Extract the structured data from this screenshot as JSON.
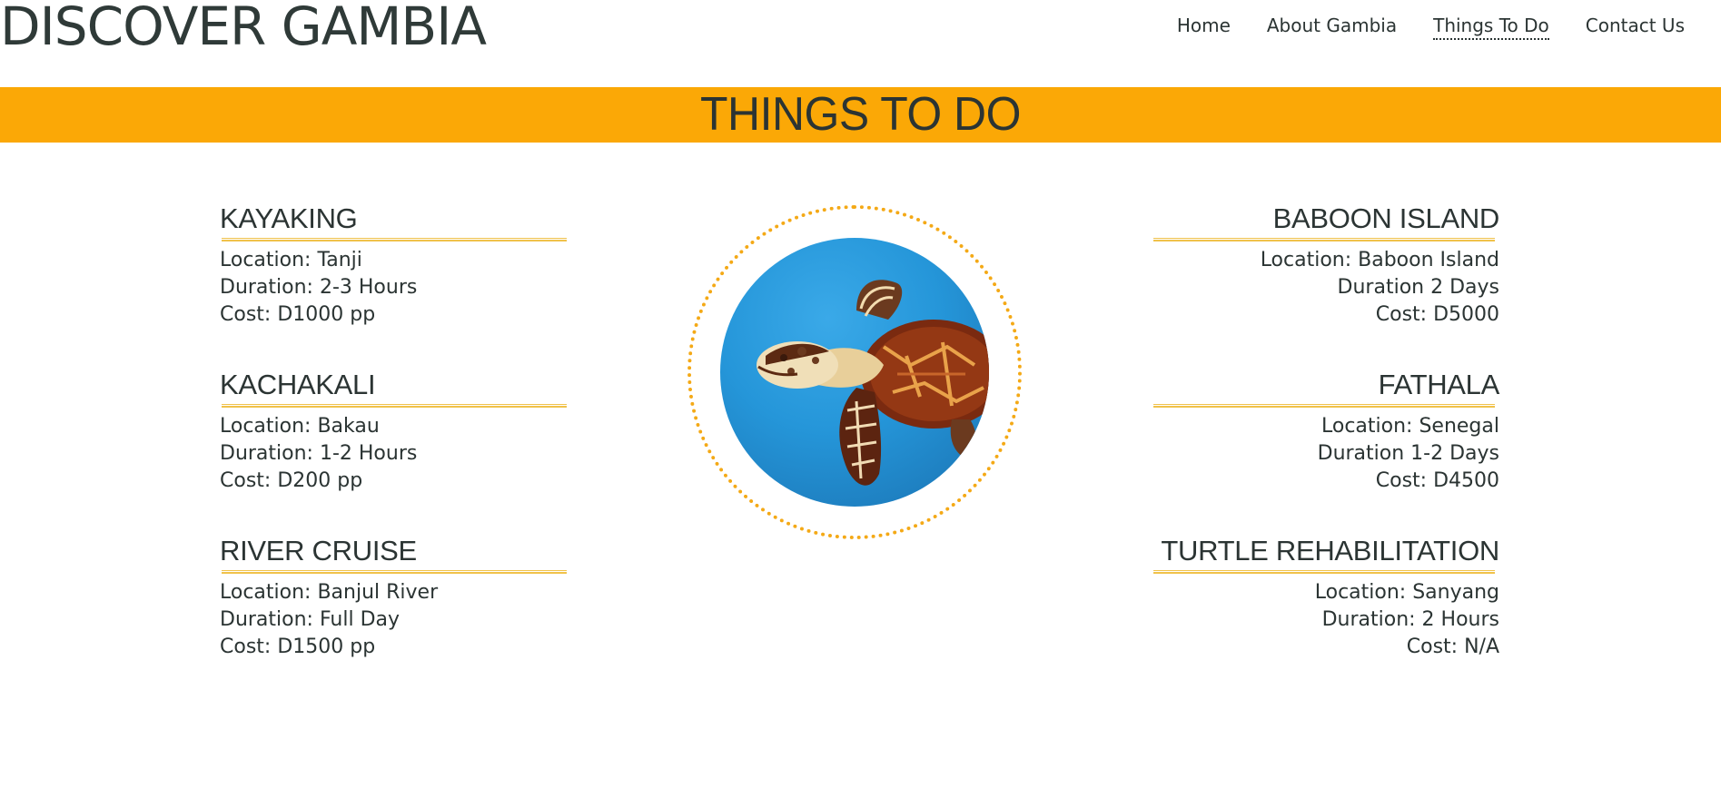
{
  "site": {
    "title": "DISCOVER GAMBIA"
  },
  "nav": {
    "items": [
      {
        "label": "Home"
      },
      {
        "label": "About Gambia"
      },
      {
        "label": "Things To Do"
      },
      {
        "label": "Contact Us"
      }
    ]
  },
  "banner": {
    "title": "THINGS TO DO"
  },
  "activities": {
    "left": [
      {
        "title": "KAYAKING",
        "location": "Location: Tanji",
        "duration": "Duration: 2-3 Hours",
        "cost": "Cost: D1000 pp"
      },
      {
        "title": "KACHAKALI",
        "location": "Location: Bakau",
        "duration": "Duration: 1-2 Hours",
        "cost": "Cost: D200 pp"
      },
      {
        "title": "RIVER CRUISE",
        "location": "Location: Banjul River",
        "duration": "Duration: Full Day",
        "cost": "Cost: D1500 pp"
      }
    ],
    "right": [
      {
        "title": "BABOON ISLAND",
        "location": "Location: Baboon Island",
        "duration": "Duration 2 Days",
        "cost": "Cost: D5000"
      },
      {
        "title": "FATHALA",
        "location": "Location: Senegal",
        "duration": "Duration 1-2 Days",
        "cost": "Cost: D4500"
      },
      {
        "title": "TURTLE REHABILITATION",
        "location": "Location: Sanyang",
        "duration": "Duration: 2 Hours",
        "cost": "Cost: N/A"
      }
    ]
  },
  "colors": {
    "banner": "#fba806",
    "accent_rule": "#f0c24b",
    "dotted_ring": "#f4a916",
    "text": "#2b3433",
    "water": "#2596d9"
  },
  "image": {
    "icon": "sea-turtle-photo"
  }
}
